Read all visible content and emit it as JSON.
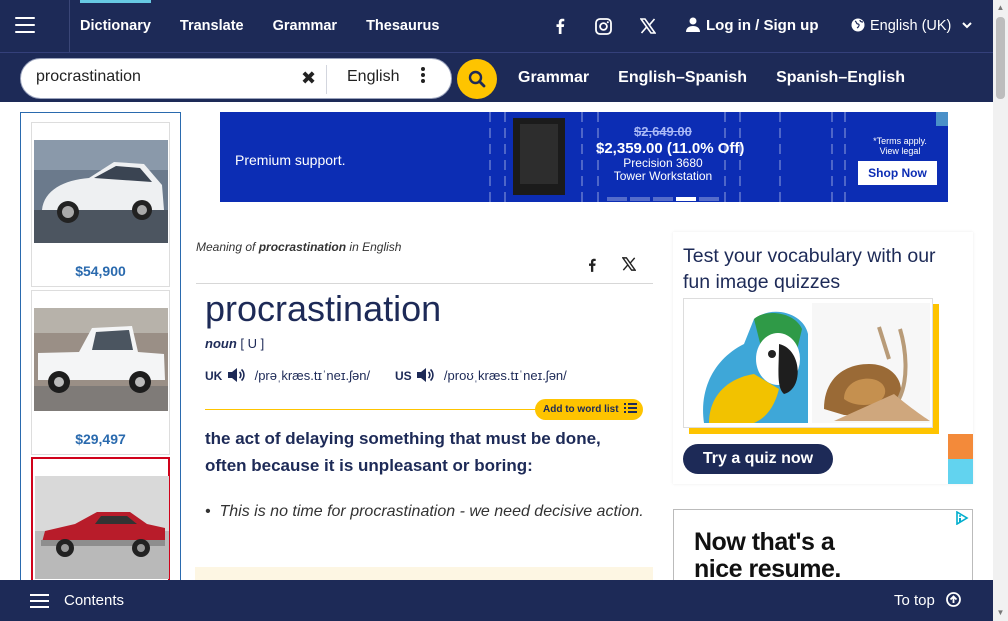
{
  "header": {
    "nav": [
      "Dictionary",
      "Translate",
      "Grammar",
      "Thesaurus"
    ],
    "active_nav": "Dictionary",
    "login_label": "Log in / Sign up",
    "language": "English (UK)"
  },
  "search": {
    "value": "procrastination",
    "dictionary": "English",
    "quick_links": [
      "Grammar",
      "English–Spanish",
      "Spanish–English"
    ]
  },
  "left_ads": [
    {
      "price": "$54,900"
    },
    {
      "price": "$29,497"
    },
    {
      "price": ""
    }
  ],
  "banner_ad": {
    "headline": "Premium support.",
    "old_price": "$2,649.00",
    "new_price": "$2,359.00 (11.0% Off)",
    "product": "Precision 3680 Tower Workstation",
    "terms": "*Terms apply. View legal",
    "cta": "Shop Now",
    "active_slide": 3,
    "slide_count": 5
  },
  "entry": {
    "meaning_prefix": "Meaning of",
    "meaning_word": "procrastination",
    "meaning_suffix": "in English",
    "headword": "procrastination",
    "pos": "noun",
    "grammar": "[ U ]",
    "uk_label": "UK",
    "uk_ipa": "/prəˌkræs.tɪˈneɪ.ʃən/",
    "us_label": "US",
    "us_ipa": "/proʊˌkræs.tɪˈneɪ.ʃən/",
    "add_to_word_list": "Add to word list",
    "definition": "the act of delaying something that must be done, often because it is unpleasant or boring:",
    "example": "This is no time for procrastination - we need decisive action."
  },
  "quiz": {
    "title": "Test your vocabulary with our fun image quizzes",
    "button": "Try a quiz now"
  },
  "ad2": {
    "text_line1": "Now that's a",
    "text_line2": "nice resume."
  },
  "footer": {
    "contents_label": "Contents",
    "to_top_label": "To top"
  },
  "colors": {
    "navy": "#1d2a57",
    "yellow": "#fec400",
    "banner_blue": "#0c2db4",
    "link_blue": "#2a6aae"
  }
}
